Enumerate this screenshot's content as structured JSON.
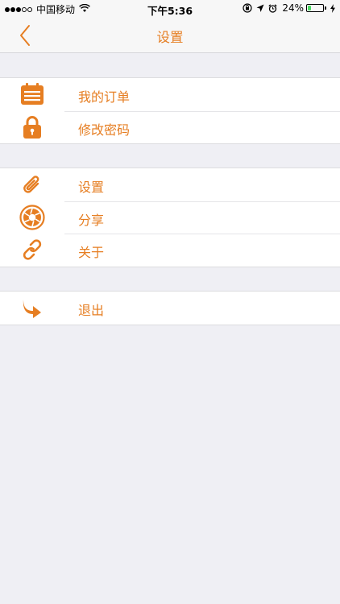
{
  "status_bar": {
    "carrier": "中国移动",
    "time": "下午5:36",
    "battery_percent": "24%",
    "battery_level": 0.24,
    "signal_bars_filled": 3,
    "signal_bars_total": 5
  },
  "nav": {
    "title": "设置",
    "back_icon": "chevron-left-icon"
  },
  "colors": {
    "accent": "#e67e22",
    "background": "#efeff4",
    "cell": "#ffffff",
    "battery": "#4cd964"
  },
  "groups": [
    {
      "items": [
        {
          "label": "我的订单",
          "icon": "calendar-list-icon"
        },
        {
          "label": "修改密码",
          "icon": "lock-icon"
        }
      ]
    },
    {
      "items": [
        {
          "label": "设置",
          "icon": "paperclip-icon"
        },
        {
          "label": "分享",
          "icon": "aperture-icon"
        },
        {
          "label": "关于",
          "icon": "link-icon"
        }
      ]
    },
    {
      "items": [
        {
          "label": "退出",
          "icon": "exit-arrow-icon"
        }
      ]
    }
  ]
}
